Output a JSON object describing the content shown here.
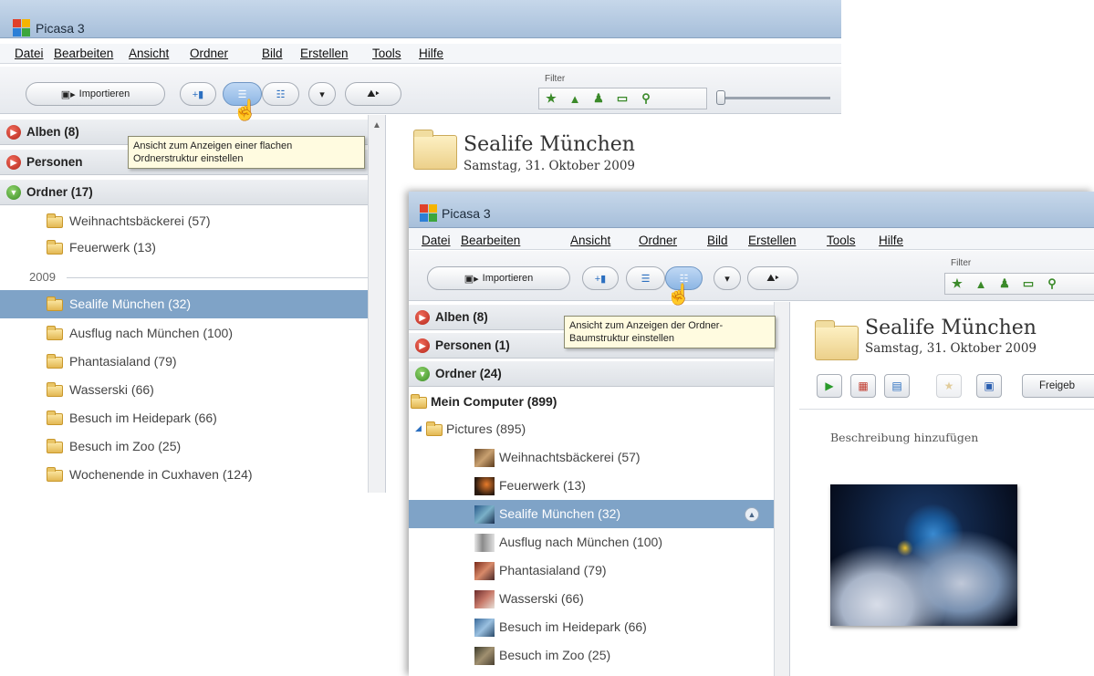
{
  "app_title": "Picasa 3",
  "menu": [
    "Datei",
    "Bearbeiten",
    "Ansicht",
    "Ordner",
    "Bild",
    "Erstellen",
    "Tools",
    "Hilfe"
  ],
  "toolbar": {
    "import_label": "Importieren",
    "filter_label": "Filter"
  },
  "window1": {
    "sections": {
      "alben": "Alben (8)",
      "personen": "Personen",
      "ordner": "Ordner (17)"
    },
    "tooltip": [
      "Ansicht zum Anzeigen einer flachen",
      "Ordnerstruktur einstellen"
    ],
    "folders_before": [
      "Weihnachtsbäckerei (57)",
      "Feuerwerk (13)"
    ],
    "year": "2009",
    "folders": [
      "Sealife München (32)",
      "Ausflug nach München (100)",
      "Phantasialand (79)",
      "Wasserski (66)",
      "Besuch im Heidepark (66)",
      "Besuch im Zoo (25)",
      "Wochenende in Cuxhaven (124)"
    ],
    "album_title": "Sealife München",
    "album_date": "Samstag, 31. Oktober 2009"
  },
  "window2": {
    "sections": {
      "alben": "Alben (8)",
      "personen": "Personen (1)",
      "ordner": "Ordner (24)"
    },
    "tooltip": [
      "Ansicht zum Anzeigen der Ordner-",
      "Baumstruktur einstellen"
    ],
    "computer": "Mein Computer (899)",
    "pictures": "Pictures (895)",
    "folders": [
      "Weihnachtsbäckerei (57)",
      "Feuerwerk (13)",
      "Sealife München (32)",
      "Ausflug nach München (100)",
      "Phantasialand (79)",
      "Wasserski (66)",
      "Besuch im Heidepark (66)",
      "Besuch im Zoo (25)"
    ],
    "album_title": "Sealife München",
    "album_date": "Samstag, 31. Oktober 2009",
    "share_label": "Freigeb",
    "description_placeholder": "Beschreibung hinzufügen"
  },
  "colors": {
    "selection": "#7fa3c7",
    "titlebar": "#b4c9e1",
    "tooltip_bg": "#fffbe0"
  }
}
